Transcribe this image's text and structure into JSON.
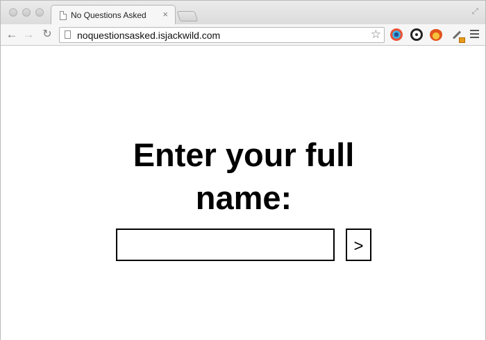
{
  "browser": {
    "tab": {
      "title": "No Questions Asked",
      "close_glyph": "×"
    },
    "nav": {
      "back_glyph": "←",
      "forward_glyph": "→",
      "reload_glyph": "↻"
    },
    "address_bar": {
      "url": "noquestionsasked.isjackwild.com",
      "bookmark_glyph": "☆"
    },
    "fullscreen_glyph": "⤢",
    "extensions": [
      "color-wheel-icon",
      "sync-icon",
      "fire-icon",
      "eyedropper-icon"
    ]
  },
  "page": {
    "heading_line1": "Enter your full",
    "heading_line2": "name:",
    "name_input": {
      "value": "",
      "placeholder": ""
    },
    "submit_label": ">"
  },
  "colors": {
    "text": "#000000",
    "background": "#ffffff",
    "border": "#000000"
  }
}
